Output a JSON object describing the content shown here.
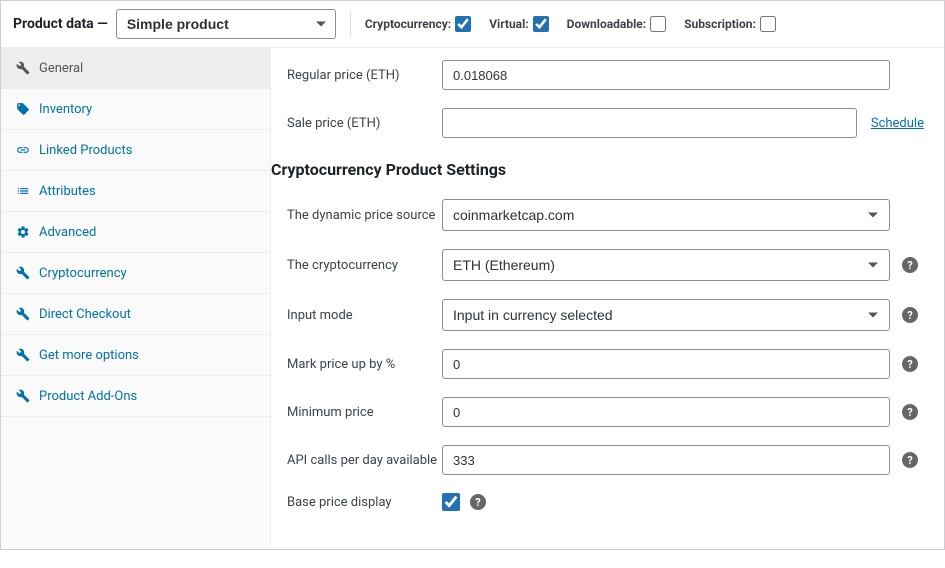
{
  "header": {
    "title": "Product data —",
    "product_type": "Simple product",
    "checkboxes": {
      "cryptocurrency": {
        "label": "Cryptocurrency:",
        "checked": true
      },
      "virtual": {
        "label": "Virtual:",
        "checked": true
      },
      "downloadable": {
        "label": "Downloadable:",
        "checked": false
      },
      "subscription": {
        "label": "Subscription:",
        "checked": false
      }
    }
  },
  "sidebar": {
    "items": [
      {
        "label": "General",
        "icon": "wrench",
        "active": true
      },
      {
        "label": "Inventory",
        "icon": "tag",
        "active": false
      },
      {
        "label": "Linked Products",
        "icon": "link",
        "active": false
      },
      {
        "label": "Attributes",
        "icon": "list",
        "active": false
      },
      {
        "label": "Advanced",
        "icon": "gear",
        "active": false
      },
      {
        "label": "Cryptocurrency",
        "icon": "wrench",
        "active": false
      },
      {
        "label": "Direct Checkout",
        "icon": "wrench",
        "active": false
      },
      {
        "label": "Get more options",
        "icon": "wrench",
        "active": false
      },
      {
        "label": "Product Add-Ons",
        "icon": "wrench",
        "active": false
      }
    ]
  },
  "fields": {
    "regular_price": {
      "label": "Regular price (ETH)",
      "value": "0.018068"
    },
    "sale_price": {
      "label": "Sale price (ETH)",
      "value": "",
      "schedule": "Schedule"
    },
    "section_heading": "Cryptocurrency Product Settings",
    "price_source": {
      "label": "The dynamic price source",
      "value": "coinmarketcap.com"
    },
    "cryptocurrency": {
      "label": "The cryptocurrency",
      "value": "ETH (Ethereum)"
    },
    "input_mode": {
      "label": "Input mode",
      "value": "Input in currency selected"
    },
    "markup": {
      "label": "Mark price up by %",
      "value": "0"
    },
    "minimum_price": {
      "label": "Minimum price",
      "value": "0"
    },
    "api_calls": {
      "label": "API calls per day available",
      "value": "333"
    },
    "base_price": {
      "label": "Base price display",
      "checked": true
    }
  }
}
